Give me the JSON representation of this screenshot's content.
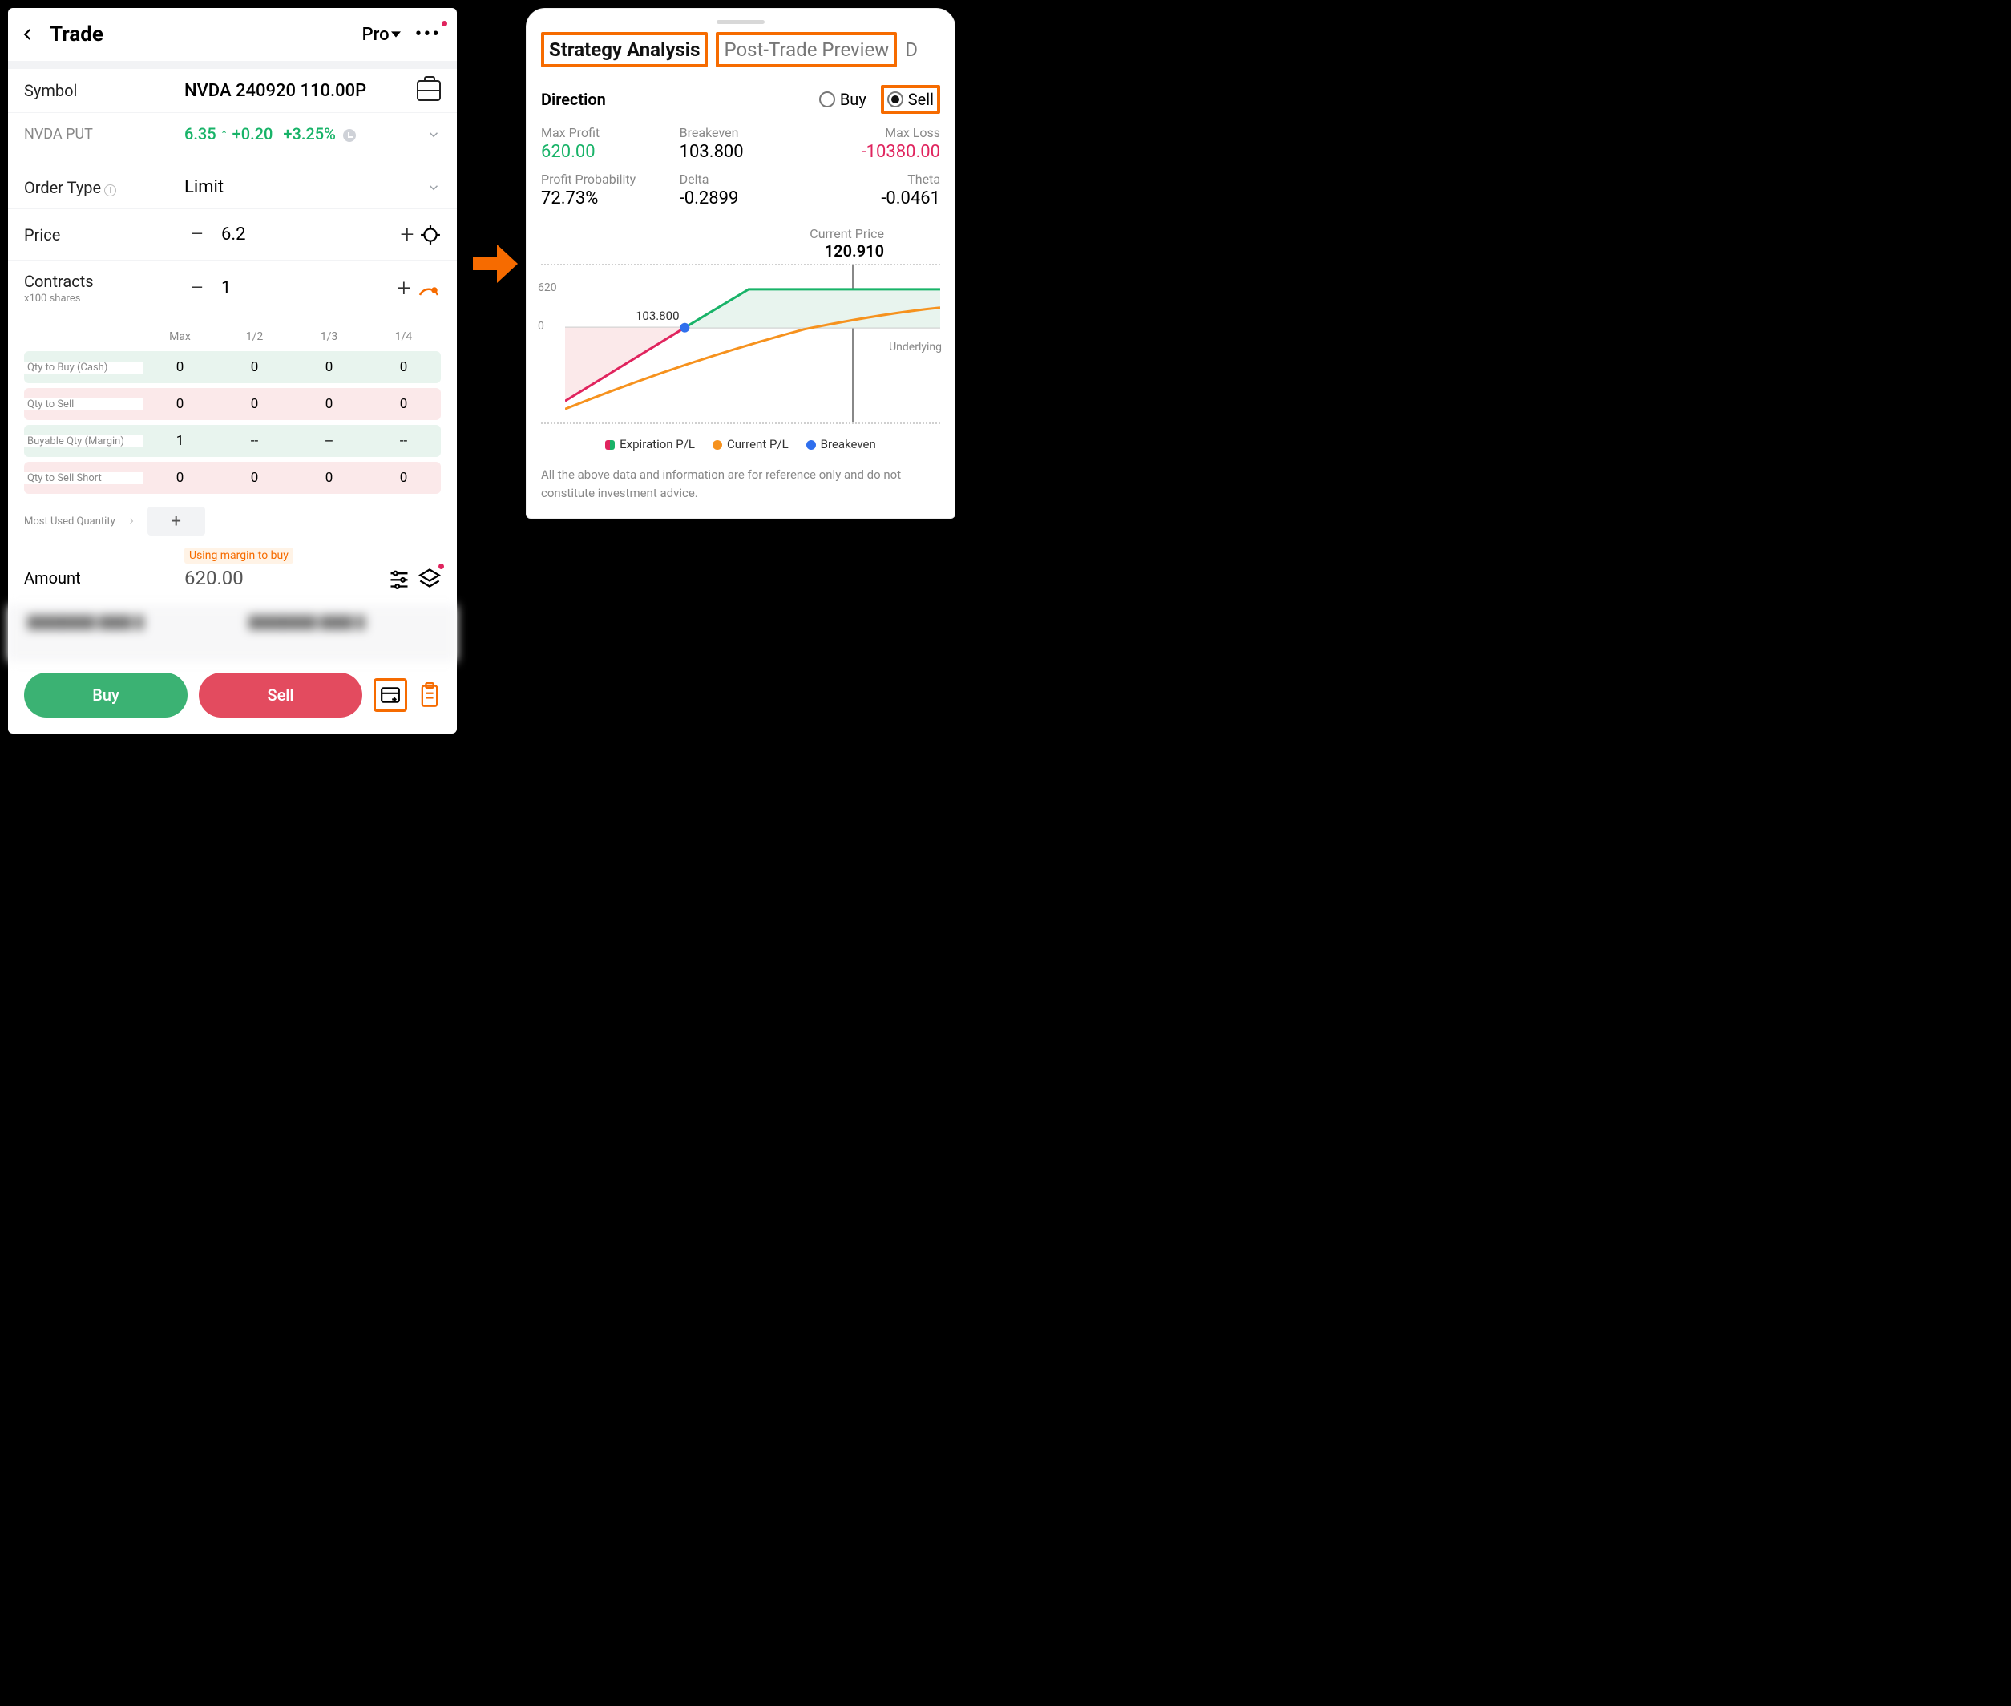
{
  "header": {
    "title": "Trade",
    "mode": "Pro"
  },
  "symbol": {
    "label": "Symbol",
    "value": "NVDA 240920 110.00P",
    "name": "NVDA PUT",
    "price": "6.35",
    "change": "+0.20",
    "pct": "+3.25%"
  },
  "orderType": {
    "label": "Order Type",
    "value": "Limit"
  },
  "price": {
    "label": "Price",
    "value": "6.2"
  },
  "contracts": {
    "label": "Contracts",
    "sub": "x100 shares",
    "value": "1"
  },
  "qty": {
    "headers": [
      "Max",
      "1/2",
      "1/3",
      "1/4"
    ],
    "rows": [
      {
        "label": "Qty to Buy (Cash)",
        "cells": [
          "0",
          "0",
          "0",
          "0"
        ],
        "type": "buy"
      },
      {
        "label": "Qty to Sell",
        "cells": [
          "0",
          "0",
          "0",
          "0"
        ],
        "type": "sell"
      },
      {
        "label": "Buyable Qty (Margin)",
        "cells": [
          "1",
          "--",
          "--",
          "--"
        ],
        "type": "buy"
      },
      {
        "label": "Qty to Sell Short",
        "cells": [
          "0",
          "0",
          "0",
          "0"
        ],
        "type": "sell"
      }
    ]
  },
  "mostUsed": "Most Used Quantity",
  "marginTag": "Using margin to buy",
  "amount": {
    "label": "Amount",
    "value": "620.00"
  },
  "buttons": {
    "buy": "Buy",
    "sell": "Sell"
  },
  "strategy": {
    "tabs": {
      "active": "Strategy Analysis",
      "next": "Post-Trade Preview",
      "cut": "D"
    },
    "direction": {
      "label": "Direction",
      "buy": "Buy",
      "sell": "Sell"
    },
    "metrics1": {
      "maxProfit": {
        "label": "Max Profit",
        "value": "620.00"
      },
      "breakeven": {
        "label": "Breakeven",
        "value": "103.800"
      },
      "maxLoss": {
        "label": "Max Loss",
        "value": "-10380.00"
      }
    },
    "metrics2": {
      "probability": {
        "label": "Profit Probability",
        "value": "72.73%"
      },
      "delta": {
        "label": "Delta",
        "value": "-0.2899"
      },
      "theta": {
        "label": "Theta",
        "value": "-0.0461"
      }
    },
    "currentPrice": {
      "label": "Current Price",
      "value": "120.910"
    },
    "chart": {
      "y620": "620",
      "y0": "0",
      "be": "103.800",
      "under": "Underlying"
    },
    "legend": {
      "exp": "Expiration P/L",
      "cur": "Current P/L",
      "be": "Breakeven"
    },
    "disclaimer": "All the above data and information are for reference only and do not constitute investment advice."
  },
  "chart_data": {
    "type": "line",
    "title": "Strategy P/L",
    "xlabel": "Underlying",
    "ylabel": "P/L",
    "ylim": [
      -10380,
      620
    ],
    "current_price_marker": 120.91,
    "breakeven_marker": 103.8,
    "series": [
      {
        "name": "Expiration P/L",
        "x": [
          0,
          103.8,
          110,
          200
        ],
        "y": [
          -10380,
          0,
          620,
          620
        ]
      },
      {
        "name": "Current P/L",
        "x": [
          80,
          103.8,
          120.91,
          150,
          200
        ],
        "y": [
          -2500,
          -550,
          0,
          300,
          500
        ]
      }
    ]
  }
}
